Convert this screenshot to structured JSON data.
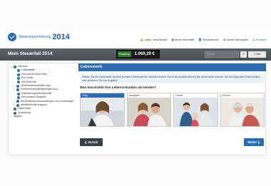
{
  "header": {
    "logo_text": "Steuersparerklärung",
    "logo_year": "2014",
    "nav": [
      {
        "label": "online, verschlüsselt",
        "icon": "lock-icon"
      },
      {
        "label": "Meine Steuerfälle",
        "icon": "grid-icon"
      },
      {
        "label": "Benutzerkonto",
        "icon": "user-icon"
      },
      {
        "label": "Andere Steuerjahre",
        "icon": "calendar-icon"
      },
      {
        "label": "Abmelden",
        "icon": "logout-icon"
      }
    ]
  },
  "titlebar": {
    "title": "Mein Steuerfall 2014",
    "refund_label": "Erstattung",
    "refund_value": "1.069,29 €",
    "search_placeholder": "Suchen",
    "help_label": "Hilfe"
  },
  "sidebar": {
    "items": [
      {
        "label": "Interview",
        "level": 0,
        "chevron": "open",
        "status": "section"
      },
      {
        "label": "Lebenswelt",
        "level": 1,
        "status": "active"
      },
      {
        "label": "Persönliche Daten Anja",
        "level": 1,
        "status": "open"
      },
      {
        "label": "Ihre Kinder",
        "level": 1,
        "status": "open"
      },
      {
        "label": "Ihre Einkünfte",
        "level": 1,
        "status": "open"
      },
      {
        "label": "Arbeitnehmereinkünfte Anja",
        "level": 0,
        "chevron": "closed",
        "status": "open"
      },
      {
        "label": "Einkommensersatzleistungen Anja",
        "level": 0,
        "chevron": "closed",
        "status": "open"
      },
      {
        "label": "Zwischenergebnis Einkünfte",
        "level": 1,
        "status": "open"
      },
      {
        "label": "Ihre privaten Ausgaben",
        "level": 1,
        "status": "open"
      },
      {
        "label": "Kirchensteuervorauszahlungen und -erstattungen",
        "level": 0,
        "chevron": "closed",
        "status": "open"
      },
      {
        "label": "Abschließende Angaben",
        "level": 0,
        "chevron": "closed",
        "status": "open"
      },
      {
        "label": "smartCheck",
        "level": 0,
        "status": "check"
      },
      {
        "label": "Auswertung",
        "level": 0,
        "status": "open"
      },
      {
        "label": "Abgabe",
        "level": 0,
        "chevron": "closed",
        "status": "none"
      }
    ]
  },
  "main": {
    "title": "Lebenswelt",
    "intro": "Wählen Sie die Lebenswelt, die Ihrer privaten Lebenswelt am nächsten kommt. Durch die Auswahl können Sie nichts falsch machen. Auf den folgenden Seiten ändern oder verfeinern Sie Ihre Angaben.",
    "question": "Was beschreibt Ihre Lebenssituation am besten?",
    "cards": [
      {
        "label": "Ledig",
        "selected": true
      },
      {
        "label": "Verheiratet",
        "selected": false
      },
      {
        "label": "Familie",
        "selected": false
      },
      {
        "label": "Rentner",
        "selected": false
      }
    ],
    "back_label": "❮ Zurück",
    "next_label": "Weiter ❯"
  },
  "colors": {
    "accent": "#2b6cb0",
    "titlebar": "#4f5257",
    "refund_badge": "#2e7d32"
  }
}
